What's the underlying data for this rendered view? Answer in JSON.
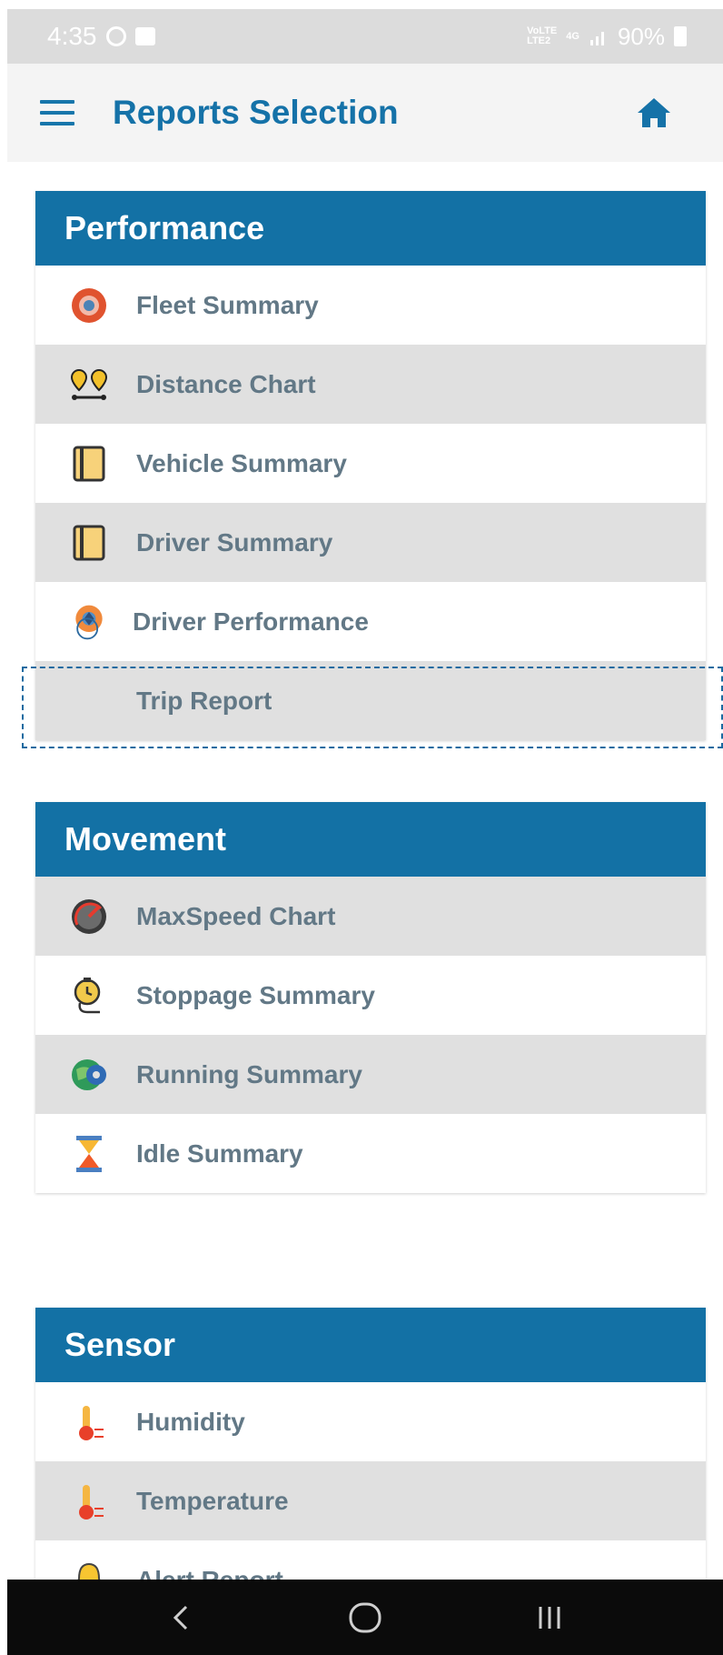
{
  "status_bar": {
    "time": "4:35",
    "network_top": "VoLTE",
    "network_bottom": "LTE2",
    "data_type": "4G",
    "battery": "90%"
  },
  "app_bar": {
    "title": "Reports Selection",
    "menu_icon": "hamburger-menu-icon",
    "home_icon": "home-icon"
  },
  "sections": [
    {
      "title": "Performance",
      "items": [
        {
          "label": "Fleet Summary",
          "icon": "fleet-icon"
        },
        {
          "label": "Distance Chart",
          "icon": "route-pins-icon"
        },
        {
          "label": "Vehicle Summary",
          "icon": "notebook-icon"
        },
        {
          "label": "Driver Summary",
          "icon": "notebook-icon"
        },
        {
          "label": "Driver Performance",
          "icon": "speed-gauge-icon"
        },
        {
          "label": "Trip Report",
          "icon": ""
        }
      ]
    },
    {
      "title": "Movement",
      "items": [
        {
          "label": "MaxSpeed Chart",
          "icon": "speedometer-icon"
        },
        {
          "label": "Stoppage Summary",
          "icon": "stopwatch-icon"
        },
        {
          "label": "Running Summary",
          "icon": "globe-gear-icon"
        },
        {
          "label": "Idle Summary",
          "icon": "hourglass-icon"
        }
      ]
    },
    {
      "title": "Sensor",
      "items": [
        {
          "label": "Humidity",
          "icon": "thermometer-icon"
        },
        {
          "label": "Temperature",
          "icon": "thermometer-icon"
        },
        {
          "label": "Alert Report",
          "icon": "bell-icon"
        }
      ]
    }
  ],
  "nav_bar": {
    "back": "back-icon",
    "home": "home-circle-icon",
    "recents": "recents-icon"
  },
  "colors": {
    "primary": "#1371a5",
    "row_grey": "#e0e0e0",
    "label": "#627886",
    "status_bar": "#dcdcdc"
  }
}
